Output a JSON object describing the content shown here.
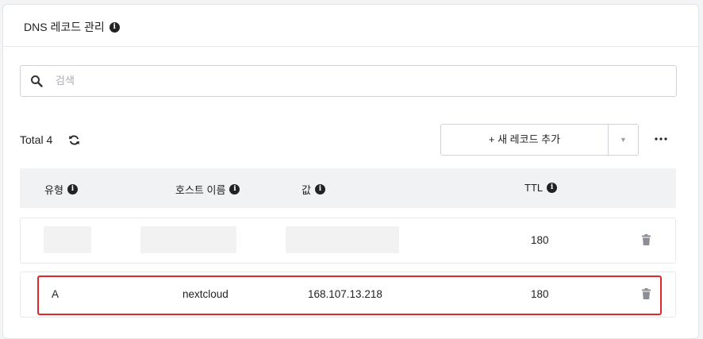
{
  "panel": {
    "title": "DNS 레코드 관리"
  },
  "search": {
    "placeholder": "검색",
    "value": ""
  },
  "toolbar": {
    "total_label": "Total 4",
    "add_record_label": "+ 새 레코드 추가"
  },
  "table": {
    "columns": [
      {
        "label": "유형"
      },
      {
        "label": "호스트 이름"
      },
      {
        "label": "값"
      },
      {
        "label": "TTL"
      }
    ],
    "rows": [
      {
        "type": "",
        "host": "",
        "value": "",
        "ttl": "180",
        "redacted": true
      },
      {
        "type": "A",
        "host": "nextcloud",
        "value": "168.107.13.218",
        "ttl": "180",
        "redacted": false,
        "highlighted": true
      }
    ]
  },
  "icons": {
    "info": "info-icon",
    "search": "search-icon",
    "refresh": "refresh-icon",
    "dropdown": "caret-down-icon",
    "more": "more-horizontal-icon",
    "delete": "trash-icon"
  },
  "colors": {
    "highlight": "#e3262e",
    "header_bg": "#f1f2f4",
    "icon": "#8a8f96"
  }
}
